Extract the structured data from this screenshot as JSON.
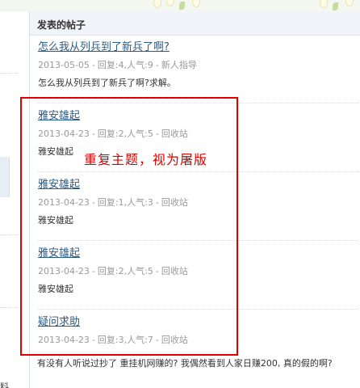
{
  "panel": {
    "title": "发表的帖子"
  },
  "posts": [
    {
      "title": "怎么我从列兵到了新兵了啊?",
      "date": "2013-05-05",
      "replies": "回复:4",
      "views": "人气:9",
      "category": "新人指导",
      "excerpt": "怎么我从列兵到了新兵了啊?求解。"
    },
    {
      "title": "雅安雄起",
      "date": "2013-04-23",
      "replies": "回复:2",
      "views": "人气:5",
      "category": "回收站",
      "excerpt": "雅安雄起"
    },
    {
      "title": "雅安雄起",
      "date": "2013-04-23",
      "replies": "回复:1",
      "views": "人气:3",
      "category": "回收站",
      "excerpt": "雅安雄起"
    },
    {
      "title": "雅安雄起",
      "date": "2013-04-23",
      "replies": "回复:2",
      "views": "人气:5",
      "category": "回收站",
      "excerpt": "雅安雄起"
    },
    {
      "title": "疑问求助",
      "date": "2013-04-23",
      "replies": "回复:3",
      "views": "人气:7",
      "category": "回收站",
      "excerpt": "有没有人听说过抄了 重挂机网赚的? 我偶然看到人家日赚200, 真的假的啊?"
    }
  ],
  "annotation": {
    "text": "重复主题，视为屠版",
    "color": "#e00000"
  },
  "left": {
    "fragment": "料"
  },
  "colors": {
    "link": "#2b5b84",
    "meta": "#999999",
    "header_bg": "#f1f4f8"
  }
}
